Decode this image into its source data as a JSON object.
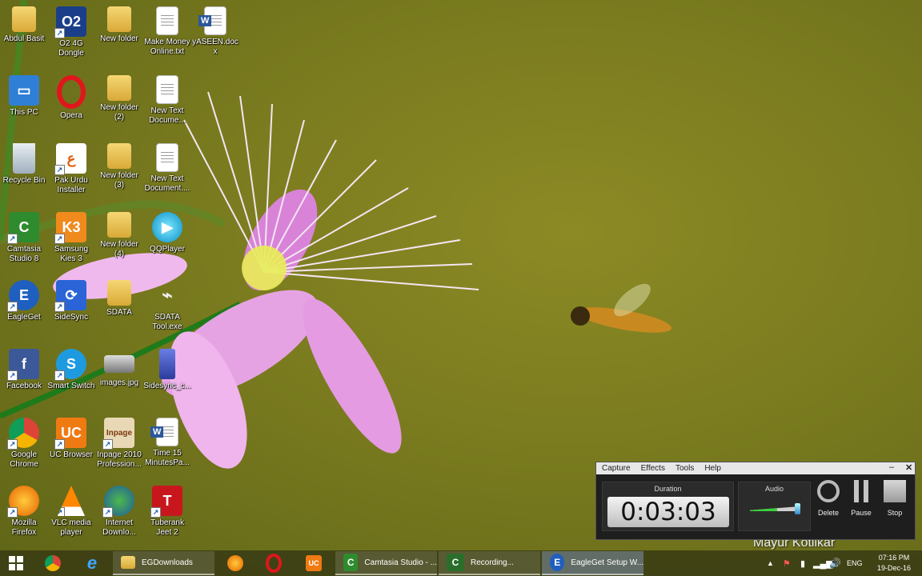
{
  "desktop_icons": [
    {
      "label": "Abdul Basit"
    },
    {
      "label": "This PC"
    },
    {
      "label": "Recycle Bin"
    },
    {
      "label": "Camtasia Studio 8"
    },
    {
      "label": "EagleGet"
    },
    {
      "label": "Facebook"
    },
    {
      "label": "Google Chrome"
    },
    {
      "label": "Mozilla Firefox"
    },
    {
      "label": "O2 4G Dongle"
    },
    {
      "label": "Opera"
    },
    {
      "label": "Pak Urdu Installer"
    },
    {
      "label": "Samsung Kies 3"
    },
    {
      "label": "SideSync"
    },
    {
      "label": "Smart Switch"
    },
    {
      "label": "UC Browser"
    },
    {
      "label": "VLC media player"
    },
    {
      "label": "New folder"
    },
    {
      "label": "New folder (2)"
    },
    {
      "label": "New folder (3)"
    },
    {
      "label": "New folder (4)"
    },
    {
      "label": "SDATA"
    },
    {
      "label": "images.jpg"
    },
    {
      "label": "Inpage 2010 Profession..."
    },
    {
      "label": "Internet Downlo..."
    },
    {
      "label": "Make Money Online.txt"
    },
    {
      "label": "New Text Docume..."
    },
    {
      "label": "New Text Document...."
    },
    {
      "label": "QQPlayer"
    },
    {
      "label": "SDATA Tool.exe"
    },
    {
      "label": "Sidesync_c..."
    },
    {
      "label": "Time 15 MinutesPa..."
    },
    {
      "label": "Tuberank Jeet 2"
    },
    {
      "label": "yASEEN.docx"
    }
  ],
  "recorder": {
    "menu": [
      "Capture",
      "Effects",
      "Tools",
      "Help"
    ],
    "duration_label": "Duration",
    "duration_value": "0:03:03",
    "audio_label": "Audio",
    "audio_level": 0.55,
    "delete_label": "Delete",
    "pause_label": "Pause",
    "stop_label": "Stop"
  },
  "taskbar": {
    "buttons": [
      {
        "label": "EGDownloads"
      },
      {
        "label": "Camtasia Studio - ..."
      },
      {
        "label": "Recording..."
      },
      {
        "label": "EagleGet Setup W..."
      }
    ],
    "language": "ENG",
    "time": "07:16 PM",
    "date": "19-Dec-16"
  },
  "watermark": "Mayur Kotlikar",
  "colors": {
    "taskbar": "#3c3e14",
    "wallpaper": "#7a7b1f",
    "flower": "#e79ae6"
  }
}
